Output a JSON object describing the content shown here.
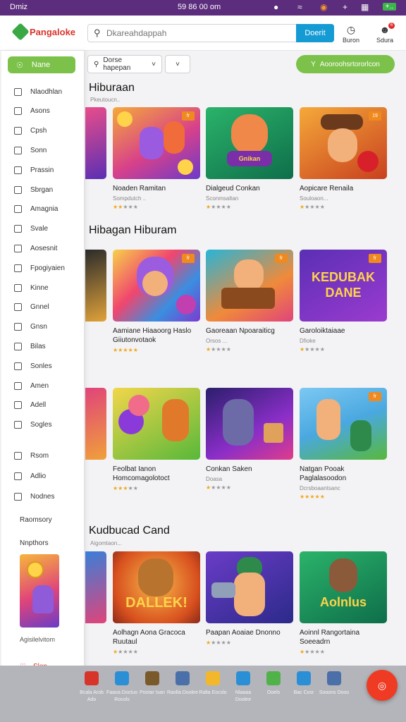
{
  "status_bar": {
    "left": "Dmiz",
    "time": "59 86 00 om",
    "battery": "+.."
  },
  "header": {
    "logo_text": "Pangaloke",
    "search_placeholder": "Dkareahdappah",
    "search_button": "Doerit",
    "actions": [
      {
        "label": "Buron",
        "badge": ""
      },
      {
        "label": "Sdura",
        "badge": "6"
      }
    ]
  },
  "sidebar": {
    "home_label": "Nane",
    "items": [
      {
        "label": "Nlaodhlan",
        "icon": "square-icon"
      },
      {
        "label": "Asons",
        "icon": "person-icon"
      },
      {
        "label": "Cpsh",
        "icon": "cart-icon"
      },
      {
        "label": "Sonn",
        "icon": "doc-icon"
      },
      {
        "label": "Prassin",
        "icon": "bell-icon"
      },
      {
        "label": "Sbrgan",
        "icon": "tag-icon"
      },
      {
        "label": "Amagnia",
        "icon": "grid-icon"
      },
      {
        "label": "Svale",
        "icon": "chat-icon"
      },
      {
        "label": "Aosesnit",
        "icon": "list-icon"
      },
      {
        "label": "Fpogiyaien",
        "icon": "calendar-icon"
      },
      {
        "label": "Kinne",
        "icon": "target-icon"
      },
      {
        "label": "Gnnel",
        "icon": "mail-icon"
      },
      {
        "label": "Gnsn",
        "icon": "globe-icon"
      },
      {
        "label": "Bilas",
        "icon": "file-icon"
      },
      {
        "label": "Sonles",
        "icon": "table-icon"
      },
      {
        "label": "Amen",
        "icon": "shield-icon"
      },
      {
        "label": "Adell",
        "icon": "gear-icon"
      },
      {
        "label": "Sogles",
        "icon": "puzzle-icon"
      }
    ],
    "items2": [
      {
        "label": "Rsom",
        "icon": "news-icon"
      },
      {
        "label": "Adlio",
        "icon": "folder-icon"
      },
      {
        "label": "Nodnes",
        "icon": "people-icon"
      }
    ],
    "section1": "Raomsory",
    "section2": "Nnpthors",
    "thumb_label": "Agisilelvitom",
    "fav_label": "Slen"
  },
  "toolbar": {
    "filter_label": "Dorse hapepan",
    "promo_label": "Aooroohsrtororlcon"
  },
  "sections": [
    {
      "title": "Hiburaan",
      "subtitle": "Pkeutoucn..",
      "cards": [
        {
          "title": "Noaden Ramitan",
          "meta": "Sompdutch ..",
          "stars": 2,
          "badge": "fr"
        },
        {
          "title": "Dialgeud Conkan",
          "meta": "Sconmsaltan",
          "stars": 1,
          "badge": ""
        },
        {
          "title": "Aopicare Renaila",
          "meta": "Souloaon...",
          "stars": 1,
          "badge": "19"
        }
      ]
    },
    {
      "title": "Hibagan Hiburam",
      "subtitle": "",
      "cards": [
        {
          "title": "Aamiane Hiaaoorg Haslo Giiutonvotaok",
          "meta": "",
          "stars": 5,
          "badge": "fr"
        },
        {
          "title": "Gaoreaan Npoaraiticg",
          "meta": "Orsos ...",
          "stars": 1,
          "badge": "fr"
        },
        {
          "title": "Garoloiktaiaae",
          "meta": "Dfioke",
          "stars": 1,
          "badge": "fr"
        }
      ]
    },
    {
      "title": "",
      "subtitle": "",
      "cards": [
        {
          "title": "Feolbat Ianon Homcomagolotoct",
          "meta": "",
          "stars": 3,
          "badge": ""
        },
        {
          "title": "Conkan Saken",
          "meta": "Doasa",
          "stars": 1,
          "badge": ""
        },
        {
          "title": "Natgan Pooak Paglalasoodon",
          "meta": "Dcrsboaantsanc",
          "stars": 5,
          "badge": "fr"
        }
      ]
    },
    {
      "title": "Kudbucad Cand",
      "subtitle": "Aigomtaon...",
      "cards": [
        {
          "title": "Aolhagn Aona Gracoca Ruutaul",
          "meta": "",
          "stars": 1,
          "badge": ""
        },
        {
          "title": "Paapan Aoaiae Dnonno",
          "meta": "",
          "stars": 1,
          "badge": ""
        },
        {
          "title": "Aoinnl Rangortaina Soeeadrn",
          "meta": "",
          "stars": 1,
          "badge": ""
        }
      ]
    }
  ],
  "thumb_texts": {
    "s1c2": "Gnikan",
    "s2c3": "KEDUBAK DANE",
    "s4c1": "DALLEK!",
    "s4c3": "Aolnlus"
  },
  "bottom_bar": [
    {
      "label": "Bcala Arob Ado",
      "color": "#d8352a"
    },
    {
      "label": "Faaoa Doctuo Rocols",
      "color": "#2b8fd6"
    },
    {
      "label": "Pootar Isan",
      "color": "#7a5a2a"
    },
    {
      "label": "Raolla Doolee",
      "color": "#4b6fa8"
    },
    {
      "label": "Ralta Eocslo",
      "color": "#f3b72c"
    },
    {
      "label": "Nlaaaa Doolee",
      "color": "#2b8fd6"
    },
    {
      "label": "Ooels",
      "color": "#52b24a"
    },
    {
      "label": "Bac Cosr",
      "color": "#2b8fd6"
    },
    {
      "label": "Sooons Dooo",
      "color": "#4b6fa8"
    }
  ]
}
